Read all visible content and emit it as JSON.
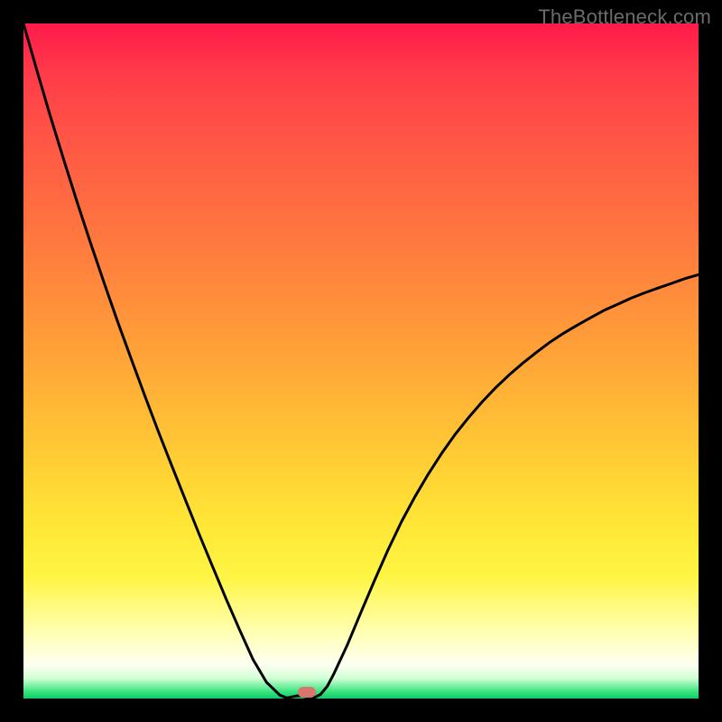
{
  "watermark": "TheBottleneck.com",
  "colors": {
    "frame": "#000000",
    "curve": "#000000",
    "marker": "#d9756f",
    "gradient_stops": [
      "#ff1a4b",
      "#ff3a49",
      "#ff5845",
      "#ff7a3e",
      "#ffa038",
      "#ffc635",
      "#ffe635",
      "#fff544",
      "#ffffb0",
      "#fdfff1",
      "#d2ffd5",
      "#36e47c",
      "#12c96b"
    ]
  },
  "chart_data": {
    "type": "line",
    "title": "",
    "xlabel": "",
    "ylabel": "",
    "xlim": [
      0.0,
      1.0
    ],
    "ylim": [
      0.0,
      1.0
    ],
    "series": [
      {
        "name": "bottleneck-curve",
        "x": [
          0.0,
          0.02,
          0.04,
          0.06,
          0.08,
          0.1,
          0.12,
          0.14,
          0.16,
          0.18,
          0.2,
          0.22,
          0.24,
          0.26,
          0.28,
          0.3,
          0.32,
          0.34,
          0.36,
          0.38,
          0.39,
          0.4,
          0.405,
          0.41,
          0.42,
          0.43,
          0.44,
          0.45,
          0.46,
          0.48,
          0.5,
          0.52,
          0.54,
          0.56,
          0.58,
          0.6,
          0.62,
          0.64,
          0.66,
          0.68,
          0.7,
          0.72,
          0.74,
          0.76,
          0.78,
          0.8,
          0.82,
          0.84,
          0.86,
          0.88,
          0.9,
          0.92,
          0.94,
          0.96,
          0.98,
          1.0
        ],
        "values": [
          0.0,
          0.07,
          0.138,
          0.203,
          0.266,
          0.327,
          0.386,
          0.443,
          0.498,
          0.552,
          0.605,
          0.656,
          0.706,
          0.756,
          0.804,
          0.852,
          0.898,
          0.942,
          0.976,
          0.995,
          0.999,
          0.997,
          0.996,
          0.996,
          0.998,
          0.999,
          0.994,
          0.982,
          0.963,
          0.92,
          0.872,
          0.825,
          0.78,
          0.738,
          0.701,
          0.667,
          0.636,
          0.608,
          0.583,
          0.56,
          0.539,
          0.52,
          0.503,
          0.487,
          0.472,
          0.459,
          0.447,
          0.436,
          0.425,
          0.416,
          0.407,
          0.399,
          0.392,
          0.385,
          0.378,
          0.372
        ]
      }
    ],
    "annotations": [
      {
        "name": "marker",
        "x": 0.42,
        "y": 0.01
      }
    ],
    "gradient_direction": "top-to-bottom (red→yellow→green)"
  }
}
